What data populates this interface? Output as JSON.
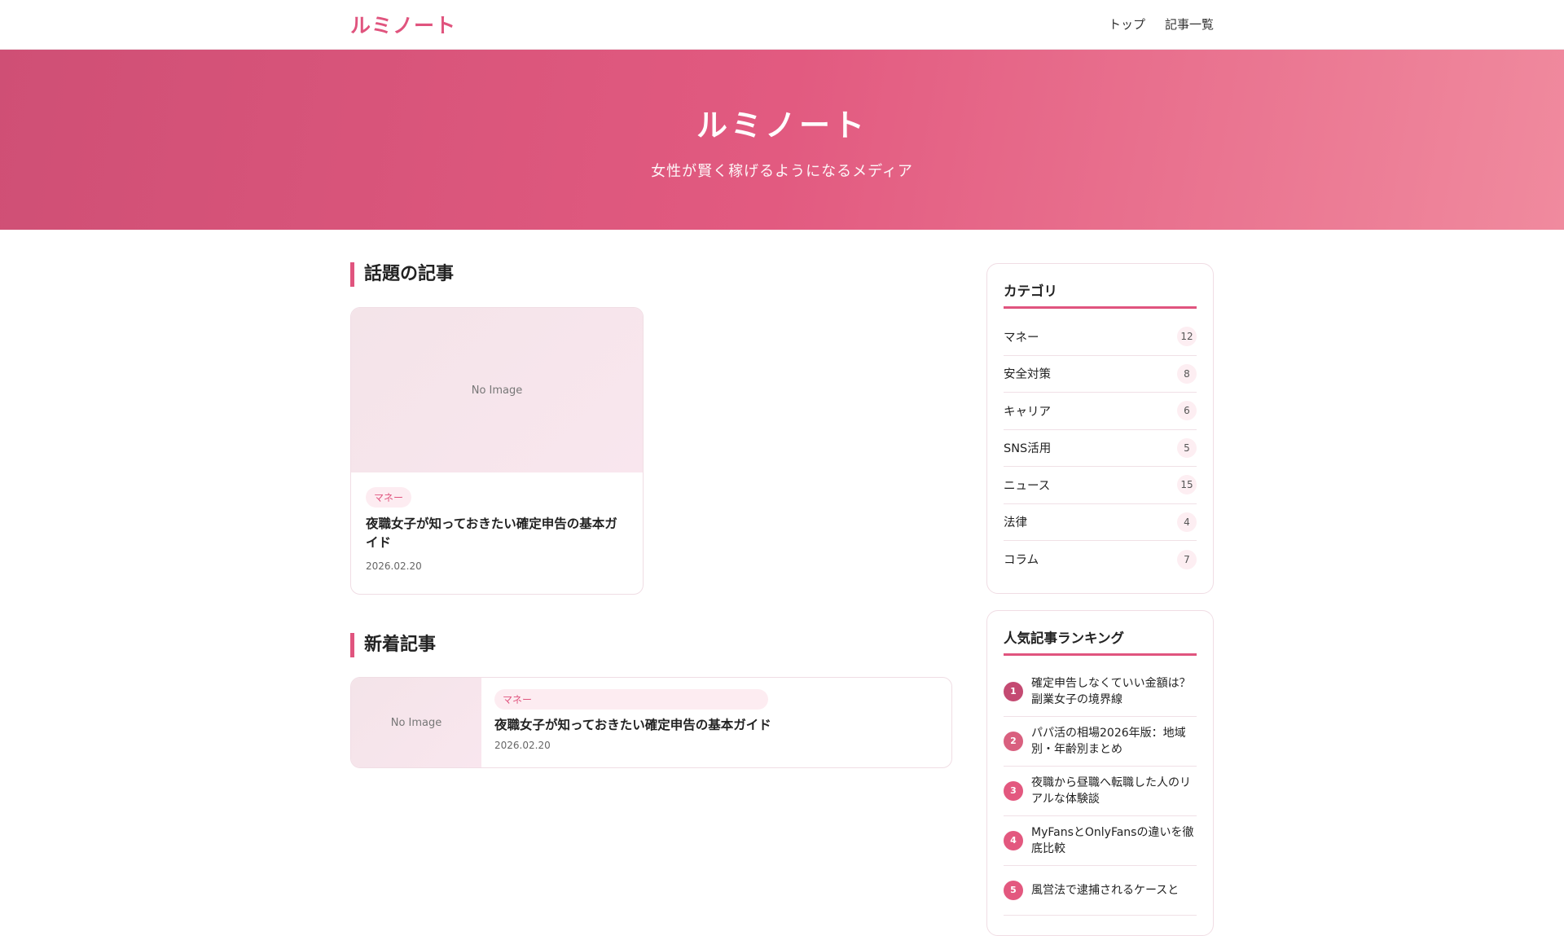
{
  "header": {
    "logo": "ルミノート",
    "nav": [
      "トップ",
      "記事一覧"
    ]
  },
  "hero": {
    "title": "ルミノート",
    "subtitle": "女性が賢く稼げるようになるメディア"
  },
  "featured": {
    "heading": "話題の記事",
    "card": {
      "image": "No Image",
      "tag": "マネー",
      "title": "夜職女子が知っておきたい確定申告の基本ガイド",
      "date": "2026.02.20"
    }
  },
  "latest": {
    "heading": "新着記事",
    "items": [
      {
        "image": "No Image",
        "tag": "マネー",
        "title": "夜職女子が知っておきたい確定申告の基本ガイド",
        "date": "2026.02.20"
      }
    ]
  },
  "categories": {
    "heading": "カテゴリ",
    "items": [
      {
        "label": "マネー",
        "count": "12"
      },
      {
        "label": "安全対策",
        "count": "8"
      },
      {
        "label": "キャリア",
        "count": "6"
      },
      {
        "label": "SNS活用",
        "count": "5"
      },
      {
        "label": "ニュース",
        "count": "15"
      },
      {
        "label": "法律",
        "count": "4"
      },
      {
        "label": "コラム",
        "count": "7"
      }
    ]
  },
  "ranking": {
    "heading": "人気記事ランキング",
    "items": [
      {
        "rank": "1",
        "title": "確定申告しなくていい金額は？副業女子の境界線",
        "color": "#c44a72"
      },
      {
        "rank": "2",
        "title": "パパ活の相場2026年版：地域別・年齢別まとめ",
        "color": "#d9607f"
      },
      {
        "rank": "3",
        "title": "夜職から昼職へ転職した人のリアルな体験談",
        "color": "#e3587f"
      },
      {
        "rank": "4",
        "title": "MyFansとOnlyFansの違いを徹底比較",
        "color": "#e3587f"
      },
      {
        "rank": "5",
        "title": "風営法で逮捕されるケースと",
        "color": "#e3587f"
      }
    ]
  }
}
